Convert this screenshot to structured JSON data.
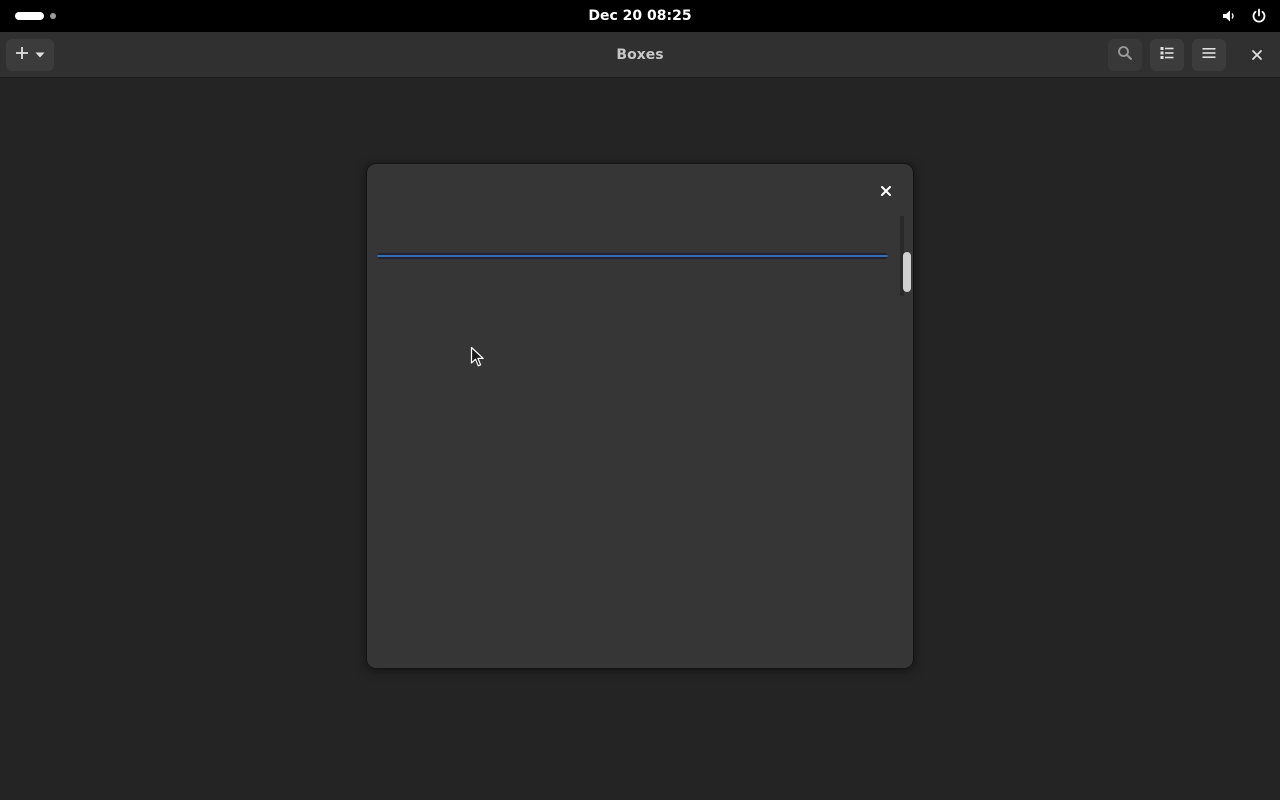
{
  "topbar": {
    "clock": "Dec 20  08:25",
    "icons": [
      "activities-indicator",
      "volume-icon",
      "power-icon"
    ]
  },
  "header": {
    "title": "Boxes",
    "new_button_icons": [
      "plus-icon",
      "chevron-down-icon"
    ],
    "right_buttons": [
      "search-icon",
      "view-list-icon",
      "hamburger-menu-icon",
      "close-icon"
    ]
  },
  "dialog": {
    "progress_fraction": 1.0,
    "close_icon": "close-icon"
  },
  "colors": {
    "accent": "#3d6bb3",
    "window_bg": "#242424",
    "dialog_bg": "#363636",
    "header_bg": "#303030",
    "topbar_bg": "#000000"
  }
}
